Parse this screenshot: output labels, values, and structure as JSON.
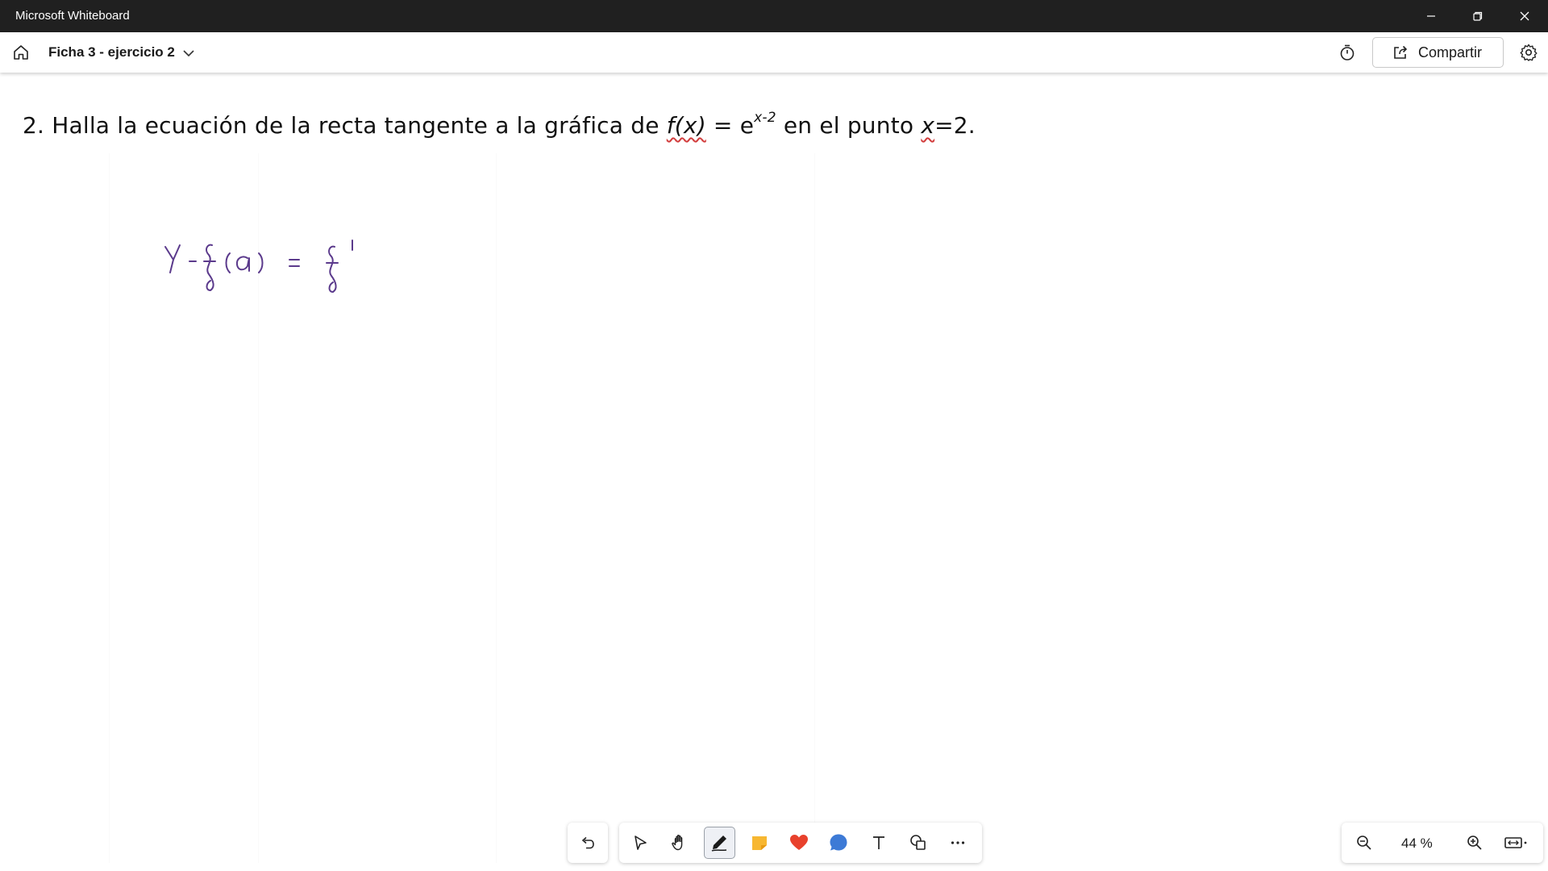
{
  "window": {
    "title": "Microsoft Whiteboard"
  },
  "header": {
    "board_title": "Ficha 3 - ejercicio 2",
    "share_label": "Compartir"
  },
  "canvas": {
    "problem": {
      "number": "2.",
      "text_before": "Halla la ecuación de la recta tangente a la gráfica de",
      "fx": "f(x)",
      "equals_e": " = e",
      "exponent": "x-2",
      "text_middle": " en el punto ",
      "x_var": "x",
      "value": "=2."
    },
    "handwriting": {
      "text": "Y - f(a) = f'",
      "ink_color": "#5b3a8c"
    }
  },
  "toolbar": {
    "tools": [
      {
        "name": "select",
        "icon": "pointer-icon"
      },
      {
        "name": "pan",
        "icon": "hand-icon"
      },
      {
        "name": "pen",
        "icon": "pen-icon",
        "active": true
      },
      {
        "name": "sticky note",
        "icon": "sticky-note-icon"
      },
      {
        "name": "reactions",
        "icon": "heart-icon"
      },
      {
        "name": "comment",
        "icon": "comment-icon"
      },
      {
        "name": "text",
        "icon": "text-icon"
      },
      {
        "name": "shapes",
        "icon": "shapes-icon"
      },
      {
        "name": "more",
        "icon": "more-icon"
      }
    ]
  },
  "zoom": {
    "level": "44 %"
  },
  "colors": {
    "titlebar": "#202020",
    "sticky": "#f7b731",
    "heart": "#e8412c",
    "comment": "#3d7ad6",
    "ink": "#5b3a8c"
  }
}
